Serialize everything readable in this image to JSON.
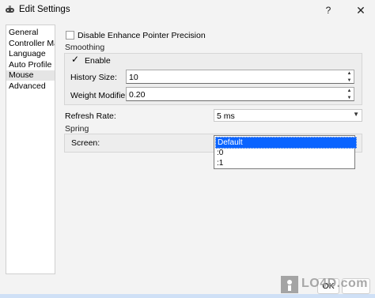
{
  "window": {
    "title": "Edit Settings",
    "help_glyph": "?",
    "close_glyph": "✕"
  },
  "nav": {
    "items": [
      {
        "label": "General"
      },
      {
        "label": "Controller Ma"
      },
      {
        "label": "Language"
      },
      {
        "label": "Auto Profile"
      },
      {
        "label": "Mouse",
        "selected": true
      },
      {
        "label": "Advanced"
      }
    ]
  },
  "mouse": {
    "disable_precision_label": "Disable Enhance Pointer Precision",
    "smoothing": {
      "group_label": "Smoothing",
      "enable_label": "Enable",
      "enable_checked": true,
      "check_glyph": "✓",
      "history_size_label": "History Size:",
      "history_size_value": "10",
      "weight_modifier_label": "Weight Modifier:",
      "weight_modifier_value": "0.20"
    },
    "refresh_rate_label": "Refresh Rate:",
    "refresh_rate_value": "5 ms",
    "spring": {
      "group_label": "Spring",
      "screen_label": "Screen:",
      "options": [
        "Default",
        ":0",
        ":1"
      ],
      "selected_option": "Default"
    }
  },
  "buttons": {
    "ok_label": "OK"
  },
  "watermark": {
    "text": "LO4D.com"
  },
  "colors": {
    "selection": "#0a64ff",
    "window_bg": "#f3f3f3"
  }
}
